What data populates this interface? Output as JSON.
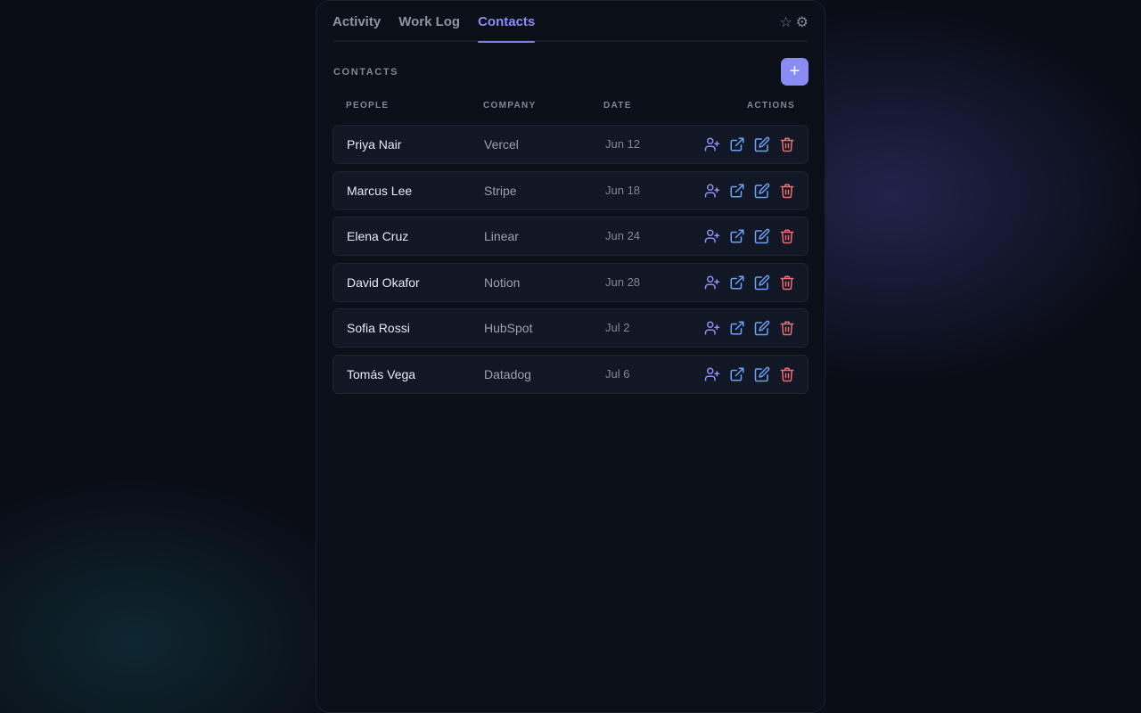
{
  "tabs": [
    {
      "label": "Activity",
      "active": false
    },
    {
      "label": "Work Log",
      "active": false
    },
    {
      "label": "Contacts",
      "active": true
    }
  ],
  "header_icons": {
    "star": "☆",
    "gear": "⚙"
  },
  "section": {
    "title": "CONTACTS",
    "add_label": "+"
  },
  "columns": {
    "people": "PEOPLE",
    "company": "COMPANY",
    "date": "DATE",
    "actions": "ACTIONS"
  },
  "contacts": [
    {
      "name": "Priya Nair",
      "company": "Vercel",
      "date": "Jun 12"
    },
    {
      "name": "Marcus Lee",
      "company": "Stripe",
      "date": "Jun 18"
    },
    {
      "name": "Elena Cruz",
      "company": "Linear",
      "date": "Jun 24"
    },
    {
      "name": "David Okafor",
      "company": "Notion",
      "date": "Jun 28"
    },
    {
      "name": "Sofia Rossi",
      "company": "HubSpot",
      "date": "Jul 2"
    },
    {
      "name": "Tomás Vega",
      "company": "Datadog",
      "date": "Jul 6"
    }
  ],
  "row_actions": [
    "add-user-icon",
    "external-link-icon",
    "edit-icon",
    "trash-icon"
  ],
  "colors": {
    "accent": "#8b8bf4",
    "action_blue": "#6aa2f7",
    "action_purple": "#8f8ff5",
    "danger": "#f06a73"
  }
}
